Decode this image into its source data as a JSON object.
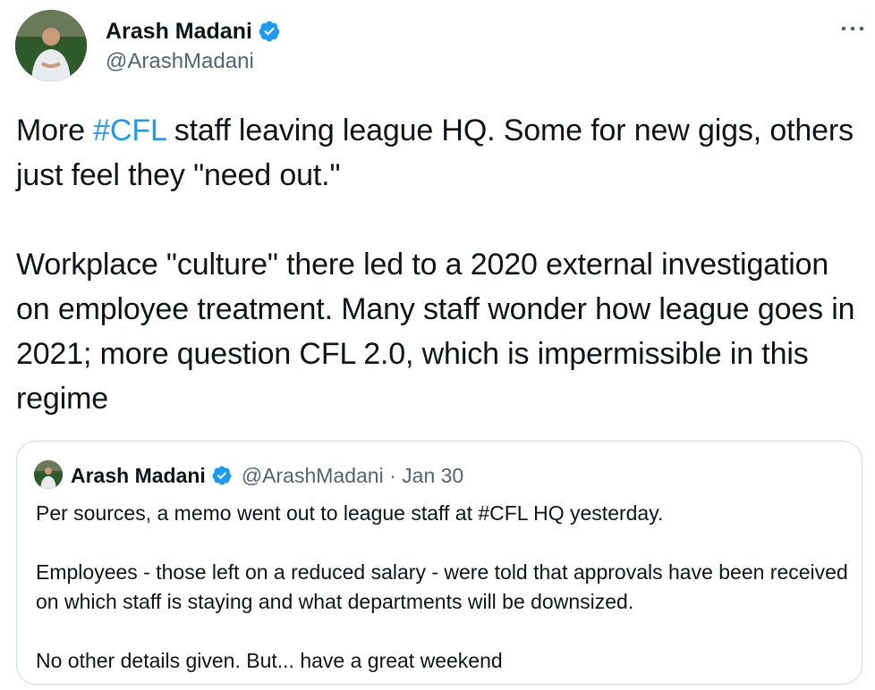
{
  "tweet": {
    "author": {
      "name": "Arash Madani",
      "handle": "@ArashMadani",
      "verified": true,
      "avatar_icon": "profile-photo"
    },
    "more_icon": "more-options-icon",
    "body": {
      "line1_prefix": "More ",
      "hashtag": "#CFL",
      "line1_suffix": " staff leaving league HQ. Some for new gigs, others just feel they \"need out.\"",
      "paragraph2": "Workplace \"culture\" there led to a 2020 external investigation on employee treatment. Many staff wonder how league goes in 2021; more question CFL 2.0, which is impermissible in this regime"
    },
    "quoted_tweet": {
      "author_name": "Arash Madani",
      "author_handle": "@ArashMadani",
      "separator": "·",
      "date": "Jan 30",
      "verified": true,
      "paragraphs": [
        "Per sources, a memo went out to league staff at #CFL HQ yesterday.",
        "Employees - those left on a reduced salary - were told that approvals have been received on which staff is staying and what departments will be downsized.",
        "No other details given. But... have a great weekend"
      ]
    }
  },
  "colors": {
    "text": "#0f1419",
    "secondary_text": "#536471",
    "accent": "#1d9bf0",
    "border": "#cfd9de"
  }
}
